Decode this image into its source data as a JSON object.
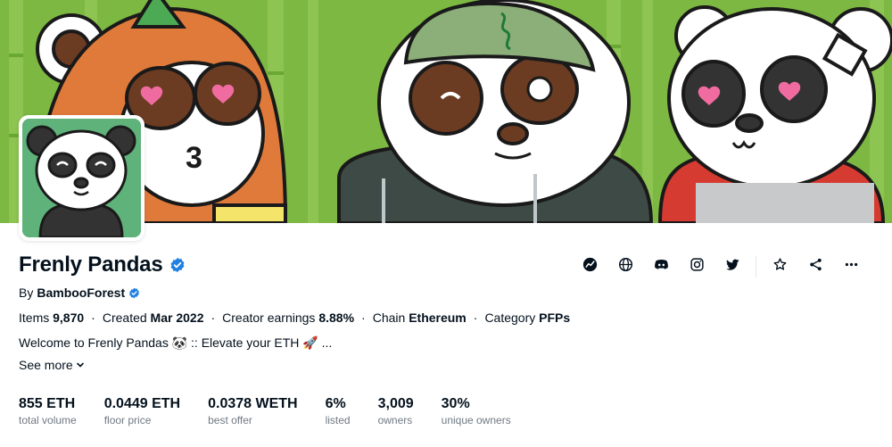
{
  "collection": {
    "name": "Frenly Pandas",
    "by_label": "By",
    "creator": "BambooForest",
    "description": "Welcome to Frenly Pandas 🐼 :: Elevate your ETH 🚀 ...",
    "see_more": "See more"
  },
  "meta": [
    {
      "key": "Items",
      "value": "9,870"
    },
    {
      "key": "Created",
      "value": "Mar 2022"
    },
    {
      "key": "Creator earnings",
      "value": "8.88%"
    },
    {
      "key": "Chain",
      "value": "Ethereum"
    },
    {
      "key": "Category",
      "value": "PFPs"
    }
  ],
  "stats": [
    {
      "value": "855 ETH",
      "label": "total volume"
    },
    {
      "value": "0.0449 ETH",
      "label": "floor price"
    },
    {
      "value": "0.0378 WETH",
      "label": "best offer"
    },
    {
      "value": "6%",
      "label": "listed"
    },
    {
      "value": "3,009",
      "label": "owners"
    },
    {
      "value": "30%",
      "label": "unique owners"
    }
  ],
  "actions": [
    "activity-icon",
    "website-icon",
    "discord-icon",
    "instagram-icon",
    "twitter-icon",
    "star-icon",
    "share-icon",
    "more-icon"
  ],
  "colors": {
    "text": "#04111d",
    "muted": "#707a83",
    "verified": "#2081e2",
    "banner_green": "#77b53f"
  }
}
